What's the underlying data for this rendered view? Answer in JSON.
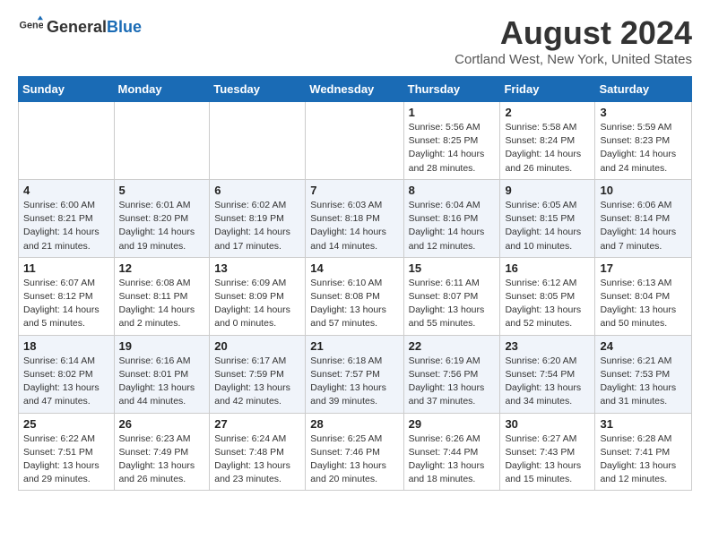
{
  "header": {
    "logo_general": "General",
    "logo_blue": "Blue",
    "title": "August 2024",
    "subtitle": "Cortland West, New York, United States"
  },
  "days_of_week": [
    "Sunday",
    "Monday",
    "Tuesday",
    "Wednesday",
    "Thursday",
    "Friday",
    "Saturday"
  ],
  "weeks": [
    [
      {
        "day": "",
        "info": ""
      },
      {
        "day": "",
        "info": ""
      },
      {
        "day": "",
        "info": ""
      },
      {
        "day": "",
        "info": ""
      },
      {
        "day": "1",
        "info": "Sunrise: 5:56 AM\nSunset: 8:25 PM\nDaylight: 14 hours\nand 28 minutes."
      },
      {
        "day": "2",
        "info": "Sunrise: 5:58 AM\nSunset: 8:24 PM\nDaylight: 14 hours\nand 26 minutes."
      },
      {
        "day": "3",
        "info": "Sunrise: 5:59 AM\nSunset: 8:23 PM\nDaylight: 14 hours\nand 24 minutes."
      }
    ],
    [
      {
        "day": "4",
        "info": "Sunrise: 6:00 AM\nSunset: 8:21 PM\nDaylight: 14 hours\nand 21 minutes."
      },
      {
        "day": "5",
        "info": "Sunrise: 6:01 AM\nSunset: 8:20 PM\nDaylight: 14 hours\nand 19 minutes."
      },
      {
        "day": "6",
        "info": "Sunrise: 6:02 AM\nSunset: 8:19 PM\nDaylight: 14 hours\nand 17 minutes."
      },
      {
        "day": "7",
        "info": "Sunrise: 6:03 AM\nSunset: 8:18 PM\nDaylight: 14 hours\nand 14 minutes."
      },
      {
        "day": "8",
        "info": "Sunrise: 6:04 AM\nSunset: 8:16 PM\nDaylight: 14 hours\nand 12 minutes."
      },
      {
        "day": "9",
        "info": "Sunrise: 6:05 AM\nSunset: 8:15 PM\nDaylight: 14 hours\nand 10 minutes."
      },
      {
        "day": "10",
        "info": "Sunrise: 6:06 AM\nSunset: 8:14 PM\nDaylight: 14 hours\nand 7 minutes."
      }
    ],
    [
      {
        "day": "11",
        "info": "Sunrise: 6:07 AM\nSunset: 8:12 PM\nDaylight: 14 hours\nand 5 minutes."
      },
      {
        "day": "12",
        "info": "Sunrise: 6:08 AM\nSunset: 8:11 PM\nDaylight: 14 hours\nand 2 minutes."
      },
      {
        "day": "13",
        "info": "Sunrise: 6:09 AM\nSunset: 8:09 PM\nDaylight: 14 hours\nand 0 minutes."
      },
      {
        "day": "14",
        "info": "Sunrise: 6:10 AM\nSunset: 8:08 PM\nDaylight: 13 hours\nand 57 minutes."
      },
      {
        "day": "15",
        "info": "Sunrise: 6:11 AM\nSunset: 8:07 PM\nDaylight: 13 hours\nand 55 minutes."
      },
      {
        "day": "16",
        "info": "Sunrise: 6:12 AM\nSunset: 8:05 PM\nDaylight: 13 hours\nand 52 minutes."
      },
      {
        "day": "17",
        "info": "Sunrise: 6:13 AM\nSunset: 8:04 PM\nDaylight: 13 hours\nand 50 minutes."
      }
    ],
    [
      {
        "day": "18",
        "info": "Sunrise: 6:14 AM\nSunset: 8:02 PM\nDaylight: 13 hours\nand 47 minutes."
      },
      {
        "day": "19",
        "info": "Sunrise: 6:16 AM\nSunset: 8:01 PM\nDaylight: 13 hours\nand 44 minutes."
      },
      {
        "day": "20",
        "info": "Sunrise: 6:17 AM\nSunset: 7:59 PM\nDaylight: 13 hours\nand 42 minutes."
      },
      {
        "day": "21",
        "info": "Sunrise: 6:18 AM\nSunset: 7:57 PM\nDaylight: 13 hours\nand 39 minutes."
      },
      {
        "day": "22",
        "info": "Sunrise: 6:19 AM\nSunset: 7:56 PM\nDaylight: 13 hours\nand 37 minutes."
      },
      {
        "day": "23",
        "info": "Sunrise: 6:20 AM\nSunset: 7:54 PM\nDaylight: 13 hours\nand 34 minutes."
      },
      {
        "day": "24",
        "info": "Sunrise: 6:21 AM\nSunset: 7:53 PM\nDaylight: 13 hours\nand 31 minutes."
      }
    ],
    [
      {
        "day": "25",
        "info": "Sunrise: 6:22 AM\nSunset: 7:51 PM\nDaylight: 13 hours\nand 29 minutes."
      },
      {
        "day": "26",
        "info": "Sunrise: 6:23 AM\nSunset: 7:49 PM\nDaylight: 13 hours\nand 26 minutes."
      },
      {
        "day": "27",
        "info": "Sunrise: 6:24 AM\nSunset: 7:48 PM\nDaylight: 13 hours\nand 23 minutes."
      },
      {
        "day": "28",
        "info": "Sunrise: 6:25 AM\nSunset: 7:46 PM\nDaylight: 13 hours\nand 20 minutes."
      },
      {
        "day": "29",
        "info": "Sunrise: 6:26 AM\nSunset: 7:44 PM\nDaylight: 13 hours\nand 18 minutes."
      },
      {
        "day": "30",
        "info": "Sunrise: 6:27 AM\nSunset: 7:43 PM\nDaylight: 13 hours\nand 15 minutes."
      },
      {
        "day": "31",
        "info": "Sunrise: 6:28 AM\nSunset: 7:41 PM\nDaylight: 13 hours\nand 12 minutes."
      }
    ]
  ]
}
